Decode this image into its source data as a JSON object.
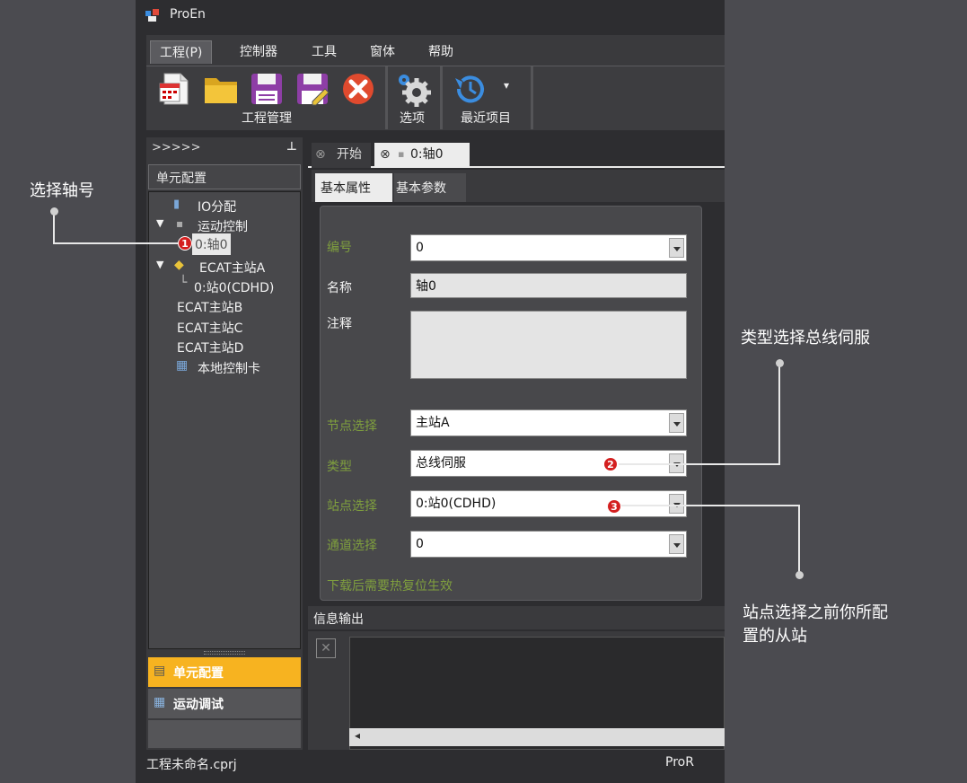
{
  "window": {
    "title": "ProEn"
  },
  "menu": [
    "工程(P)",
    "控制器",
    "工具",
    "窗体",
    "帮助"
  ],
  "ribbon": {
    "group1_label": "工程管理",
    "group2_label": "选项",
    "group3_label": "最近项目",
    "buttons": [
      "new-file-icon",
      "open-folder-icon",
      "save-icon",
      "save-as-icon",
      "close-project-icon"
    ]
  },
  "left_panel": {
    "header": ">>>>>",
    "pin": "ᵖ",
    "title": "单元配置",
    "tree": {
      "io": "IO分配",
      "motion": "运动控制",
      "axis0": "0:轴0",
      "master_a": "ECAT主站A",
      "station0": "0:站0(CDHD)",
      "master_b": "ECAT主站B",
      "master_c": "ECAT主站C",
      "master_d": "ECAT主站D",
      "local_card": "本地控制卡"
    },
    "nav": [
      "单元配置",
      "运动调试"
    ]
  },
  "tabs": {
    "start": "开始",
    "axis": "0:轴0"
  },
  "subtabs": {
    "basic_props": "基本属性",
    "basic_params": "基本参数"
  },
  "props": {
    "id_label": "编号",
    "id_value": "0",
    "name_label": "名称",
    "name_value": "轴0",
    "comment_label": "注释",
    "node_label": "节点选择",
    "node_value": "主站A",
    "type_label": "类型",
    "type_value": "总线伺服",
    "station_label": "站点选择",
    "station_value": "0:站0(CDHD)",
    "channel_label": "通道选择",
    "channel_value": "0",
    "note": "下载后需要热复位生效"
  },
  "output": {
    "title": "信息输出"
  },
  "status": {
    "file": "工程未命名.cprj",
    "right": "ProR"
  },
  "annotations": {
    "a1": "选择轴号",
    "a2": "类型选择总线伺服",
    "a3_line1": "站点选择之前你所配",
    "a3_line2": "置的从站",
    "badge1": "1",
    "badge2": "2",
    "badge3": "3"
  }
}
